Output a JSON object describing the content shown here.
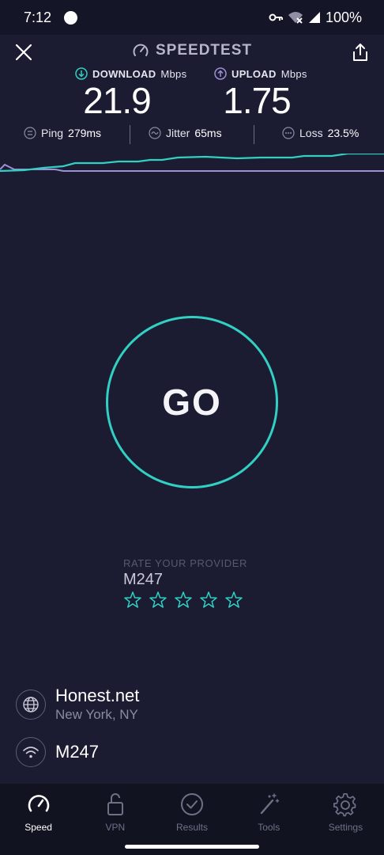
{
  "status_bar": {
    "time": "7:12",
    "battery": "100%"
  },
  "header": {
    "title": "SPEEDTEST"
  },
  "download": {
    "label": "DOWNLOAD",
    "unit": "Mbps",
    "value": "21.9"
  },
  "upload": {
    "label": "UPLOAD",
    "unit": "Mbps",
    "value": "1.75"
  },
  "stats": {
    "ping": {
      "label": "Ping",
      "value": "279ms"
    },
    "jitter": {
      "label": "Jitter",
      "value": "65ms"
    },
    "loss": {
      "label": "Loss",
      "value": "23.5%"
    }
  },
  "go_button": {
    "label": "GO"
  },
  "rate": {
    "title": "RATE YOUR PROVIDER",
    "provider": "M247",
    "stars": 5
  },
  "server": {
    "name": "Honest.net",
    "location": "New York, NY"
  },
  "network": {
    "name": "M247"
  },
  "nav": {
    "speed": "Speed",
    "vpn": "VPN",
    "results": "Results",
    "tools": "Tools",
    "settings": "Settings"
  },
  "colors": {
    "accent_teal": "#31d0c3",
    "upload_line": "#9d8fd6",
    "background": "#1b1c31",
    "nav_background": "#121320"
  }
}
